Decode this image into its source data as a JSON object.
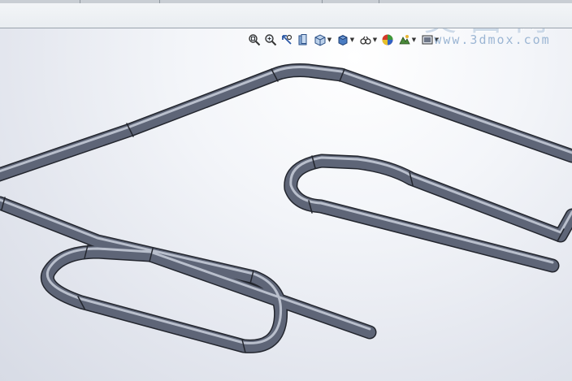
{
  "window": {
    "tab_segments": [
      "",
      "",
      "",
      ""
    ]
  },
  "toolbar": {
    "buttons": [
      {
        "id": "zoom-to-fit",
        "icon": "zoom-to-fit-icon"
      },
      {
        "id": "zoom-to-area",
        "icon": "zoom-to-area-icon"
      },
      {
        "id": "previous-view",
        "icon": "previous-view-icon"
      },
      {
        "id": "section-view",
        "icon": "section-view-icon"
      },
      {
        "id": "view-orientation",
        "icon": "view-orientation-icon",
        "dropdown": true
      },
      {
        "id": "display-style",
        "icon": "display-style-icon",
        "dropdown": true
      },
      {
        "id": "hide-show-items",
        "icon": "hide-show-items-icon",
        "dropdown": true
      },
      {
        "id": "edit-appearance",
        "icon": "appearance-icon"
      },
      {
        "id": "apply-scene",
        "icon": "scene-icon",
        "dropdown": true
      },
      {
        "id": "view-settings",
        "icon": "view-settings-icon",
        "dropdown": true
      }
    ]
  },
  "watermark": {
    "logo_text": "莫西网",
    "url": "www.3dmox.com"
  },
  "model": {
    "description_color": "#5e6577",
    "tube_color": "#5e6577",
    "highlight_color": "#b9bfcc",
    "edge_color": "#23262e"
  }
}
